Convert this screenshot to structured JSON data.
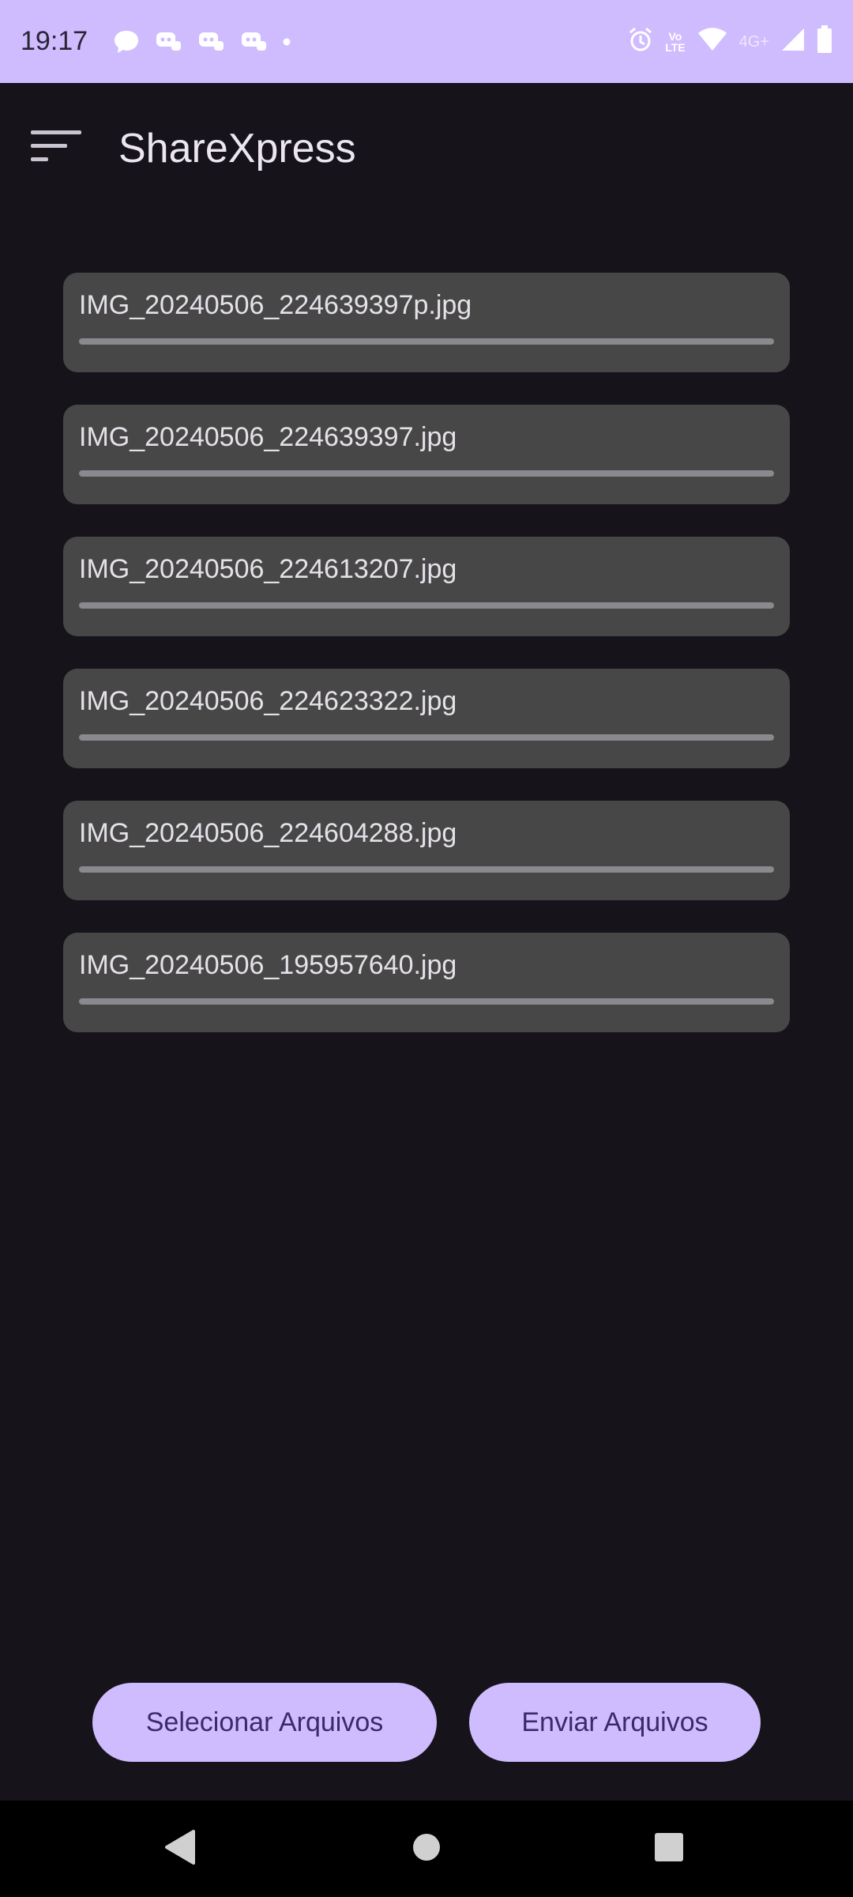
{
  "status_bar": {
    "time": "19:17",
    "network_label": "4G+",
    "volte_top": "Vo",
    "volte_bottom": "LTE",
    "notification_icons": [
      "chat-bubble-icon",
      "discord-icon",
      "discord-icon",
      "discord-icon",
      "dot-icon"
    ],
    "system_icons": [
      "alarm-icon",
      "volte-icon",
      "wifi-icon",
      "signal-icon",
      "battery-icon"
    ]
  },
  "app_bar": {
    "title": "ShareXpress",
    "menu_icon": "sort-menu-icon"
  },
  "files": [
    {
      "name": "IMG_20240506_224639397p.jpg",
      "progress": 0
    },
    {
      "name": "IMG_20240506_224639397.jpg",
      "progress": 0
    },
    {
      "name": "IMG_20240506_224613207.jpg",
      "progress": 0
    },
    {
      "name": "IMG_20240506_224623322.jpg",
      "progress": 0
    },
    {
      "name": "IMG_20240506_224604288.jpg",
      "progress": 0
    },
    {
      "name": "IMG_20240506_195957640.jpg",
      "progress": 0
    }
  ],
  "actions": {
    "select_label": "Selecionar Arquivos",
    "send_label": "Enviar Arquivos"
  },
  "nav": {
    "back_icon": "back-triangle-icon",
    "home_icon": "home-circle-icon",
    "recent_icon": "recents-square-icon"
  },
  "colors": {
    "accent": "#cfbcff",
    "background": "#16141a",
    "card": "#474747"
  }
}
